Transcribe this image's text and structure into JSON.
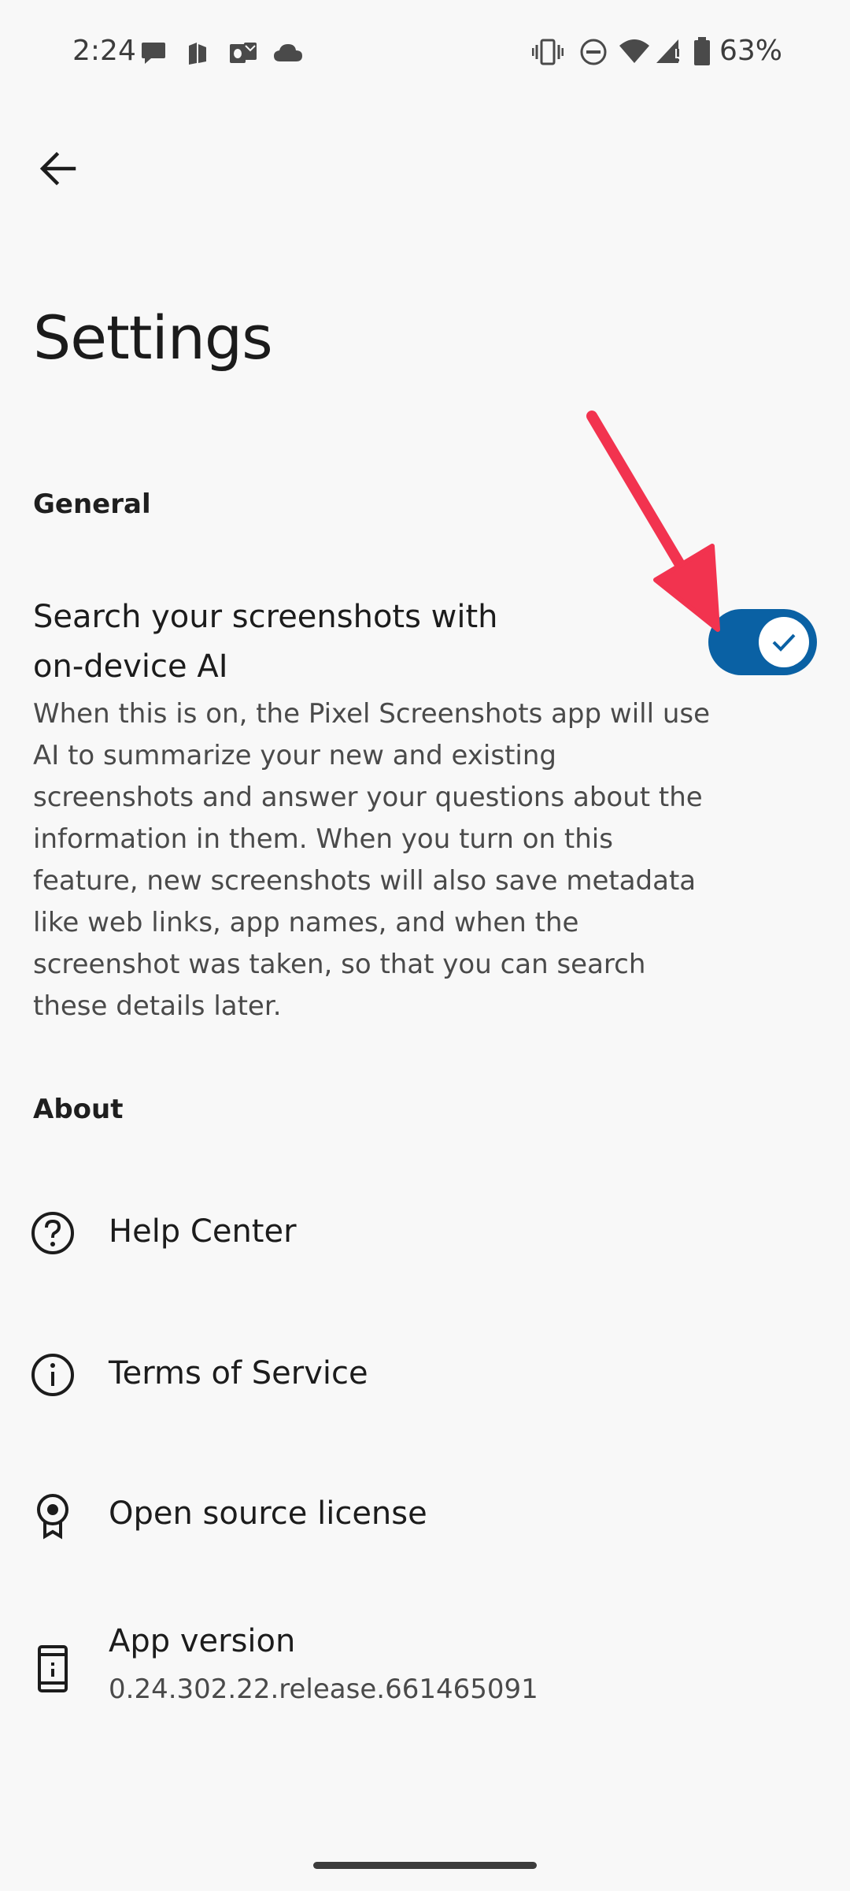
{
  "status_bar": {
    "time": "2:24",
    "battery_percent": "63%",
    "left_icons": [
      "chat-bubble-icon",
      "files-icon",
      "outlook-icon",
      "cloud-icon"
    ],
    "right_icons": [
      "vibrate-icon",
      "do-not-disturb-icon",
      "wifi-icon",
      "signal-icon",
      "battery-icon"
    ]
  },
  "header": {
    "back_icon": "arrow-back-icon",
    "title": "Settings"
  },
  "general": {
    "header": "General",
    "ai_search": {
      "title": "Search your screenshots with on-device AI",
      "description": "When this is on, the Pixel Screenshots app will use AI to summarize your new and existing screenshots and answer your questions about the information in them. When you turn on this feature, new screenshots will also save metadata like web links, app names, and when the screenshot was taken, so that you can search these details later.",
      "enabled": true
    }
  },
  "about": {
    "header": "About",
    "items": [
      {
        "label": "Help Center",
        "icon": "help-circle-icon"
      },
      {
        "label": "Terms of Service",
        "icon": "info-icon"
      },
      {
        "label": "Open source license",
        "icon": "badge-icon"
      },
      {
        "label": "App version",
        "sublabel": "0.24.302.22.release.661465091",
        "icon": "phone-icon"
      }
    ]
  },
  "colors": {
    "toggle_on": "#0a61a4",
    "annotation_arrow": "#f2334f"
  }
}
